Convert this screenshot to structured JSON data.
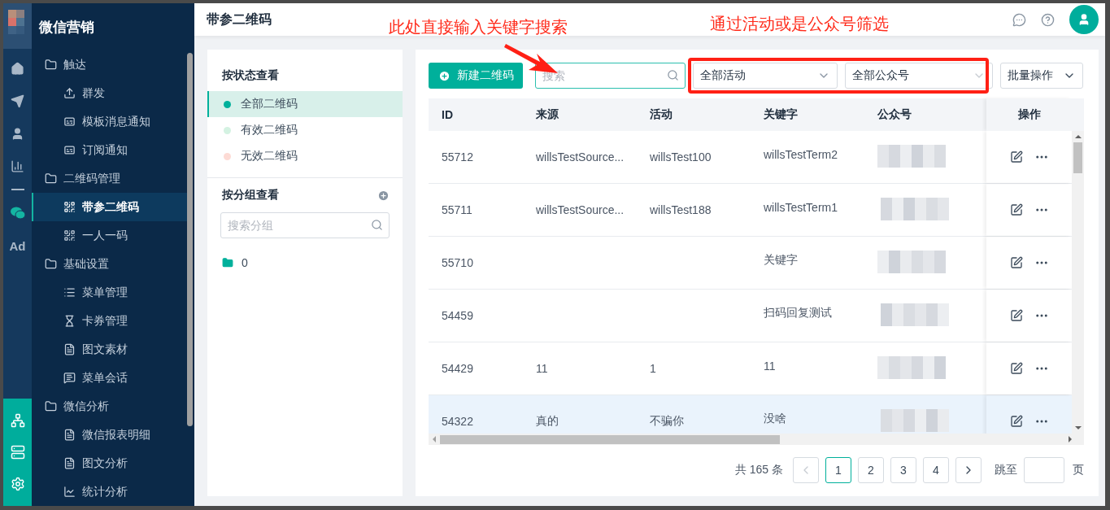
{
  "rail": {
    "items": [
      {
        "kind": "home",
        "selected": false
      },
      {
        "kind": "send",
        "selected": false
      },
      {
        "kind": "user",
        "selected": false
      },
      {
        "kind": "chart",
        "selected": false
      },
      {
        "kind": "rule"
      },
      {
        "kind": "wechat",
        "selected": true
      },
      {
        "kind": "text",
        "label": "Ad",
        "selected": false
      }
    ],
    "bottom_items": [
      {
        "kind": "network"
      },
      {
        "kind": "server"
      },
      {
        "kind": "settings"
      }
    ]
  },
  "sidebar": {
    "title": "微信营销",
    "groups": [
      {
        "label": "触达",
        "children": [
          {
            "label": "群发",
            "kind": "upload",
            "selected": false
          },
          {
            "label": "模板消息通知",
            "kind": "card",
            "selected": false
          },
          {
            "label": "订阅通知",
            "kind": "card",
            "selected": false
          }
        ]
      },
      {
        "label": "二维码管理",
        "children": [
          {
            "label": "带参二维码",
            "kind": "qr",
            "selected": true
          },
          {
            "label": "一人一码",
            "kind": "qr",
            "selected": false
          }
        ]
      },
      {
        "label": "基础设置",
        "children": [
          {
            "label": "菜单管理",
            "kind": "list",
            "selected": false
          },
          {
            "label": "卡券管理",
            "kind": "hourglass",
            "selected": false
          },
          {
            "label": "图文素材",
            "kind": "doc",
            "selected": false
          },
          {
            "label": "菜单会话",
            "kind": "chat",
            "selected": false
          }
        ]
      },
      {
        "label": "微信分析",
        "children": [
          {
            "label": "微信报表明细",
            "kind": "doc",
            "selected": false
          },
          {
            "label": "图文分析",
            "kind": "doc",
            "selected": false
          },
          {
            "label": "统计分析",
            "kind": "linechart",
            "selected": false
          }
        ]
      }
    ]
  },
  "header": {
    "title": "带参二维码"
  },
  "status_panel": {
    "title": "按状态查看",
    "items": [
      {
        "label": "全部二维码",
        "selected": true,
        "color": "#00b09b"
      },
      {
        "label": "有效二维码",
        "selected": false,
        "color": "#d4f2e2"
      },
      {
        "label": "无效二维码",
        "selected": false,
        "color": "#fddbd5"
      }
    ]
  },
  "group_panel": {
    "title": "按分组查看",
    "search": {
      "placeholder": "搜索分组"
    },
    "folders": [
      {
        "label": "0"
      }
    ]
  },
  "toolbar": {
    "new_button": "新建二维码",
    "search": {
      "placeholder": "搜索"
    },
    "activity_select": "全部活动",
    "account_select": "全部公众号",
    "batch_button": "批量操作"
  },
  "table": {
    "columns": [
      "ID",
      "来源",
      "活动",
      "关键字",
      "公众号",
      "操作"
    ],
    "rows": [
      {
        "id": "55712",
        "source": "willsTestSource...",
        "activity": "willsTest100",
        "keyword": "willsTestTerm2",
        "hovered": false
      },
      {
        "id": "55711",
        "source": "willsTestSource...",
        "activity": "willsTest188",
        "keyword": "willsTestTerm1",
        "hovered": false
      },
      {
        "id": "55710",
        "keyword": "关键字",
        "hovered": false
      },
      {
        "id": "54459",
        "keyword": "扫码回复测试",
        "hovered": false
      },
      {
        "id": "54429",
        "source": "11",
        "activity": "1",
        "keyword": "11",
        "hovered": false
      },
      {
        "id": "54322",
        "source": "真的",
        "activity": "不骗你",
        "keyword": "没啥",
        "hovered": true
      }
    ]
  },
  "pagination": {
    "total": "共 165 条",
    "pages": [
      {
        "label": "1",
        "selected": true
      },
      {
        "label": "2",
        "selected": false
      },
      {
        "label": "3",
        "selected": false
      },
      {
        "label": "4",
        "selected": false
      }
    ],
    "jump_label": "跳至",
    "page_suffix": "页"
  },
  "annotations": [
    {
      "kind": "text",
      "text": "此处直接输入关键字搜索"
    },
    {
      "kind": "text",
      "text": "通过活动或是公众号筛选"
    },
    {
      "kind": "arrow"
    },
    {
      "kind": "box"
    }
  ]
}
